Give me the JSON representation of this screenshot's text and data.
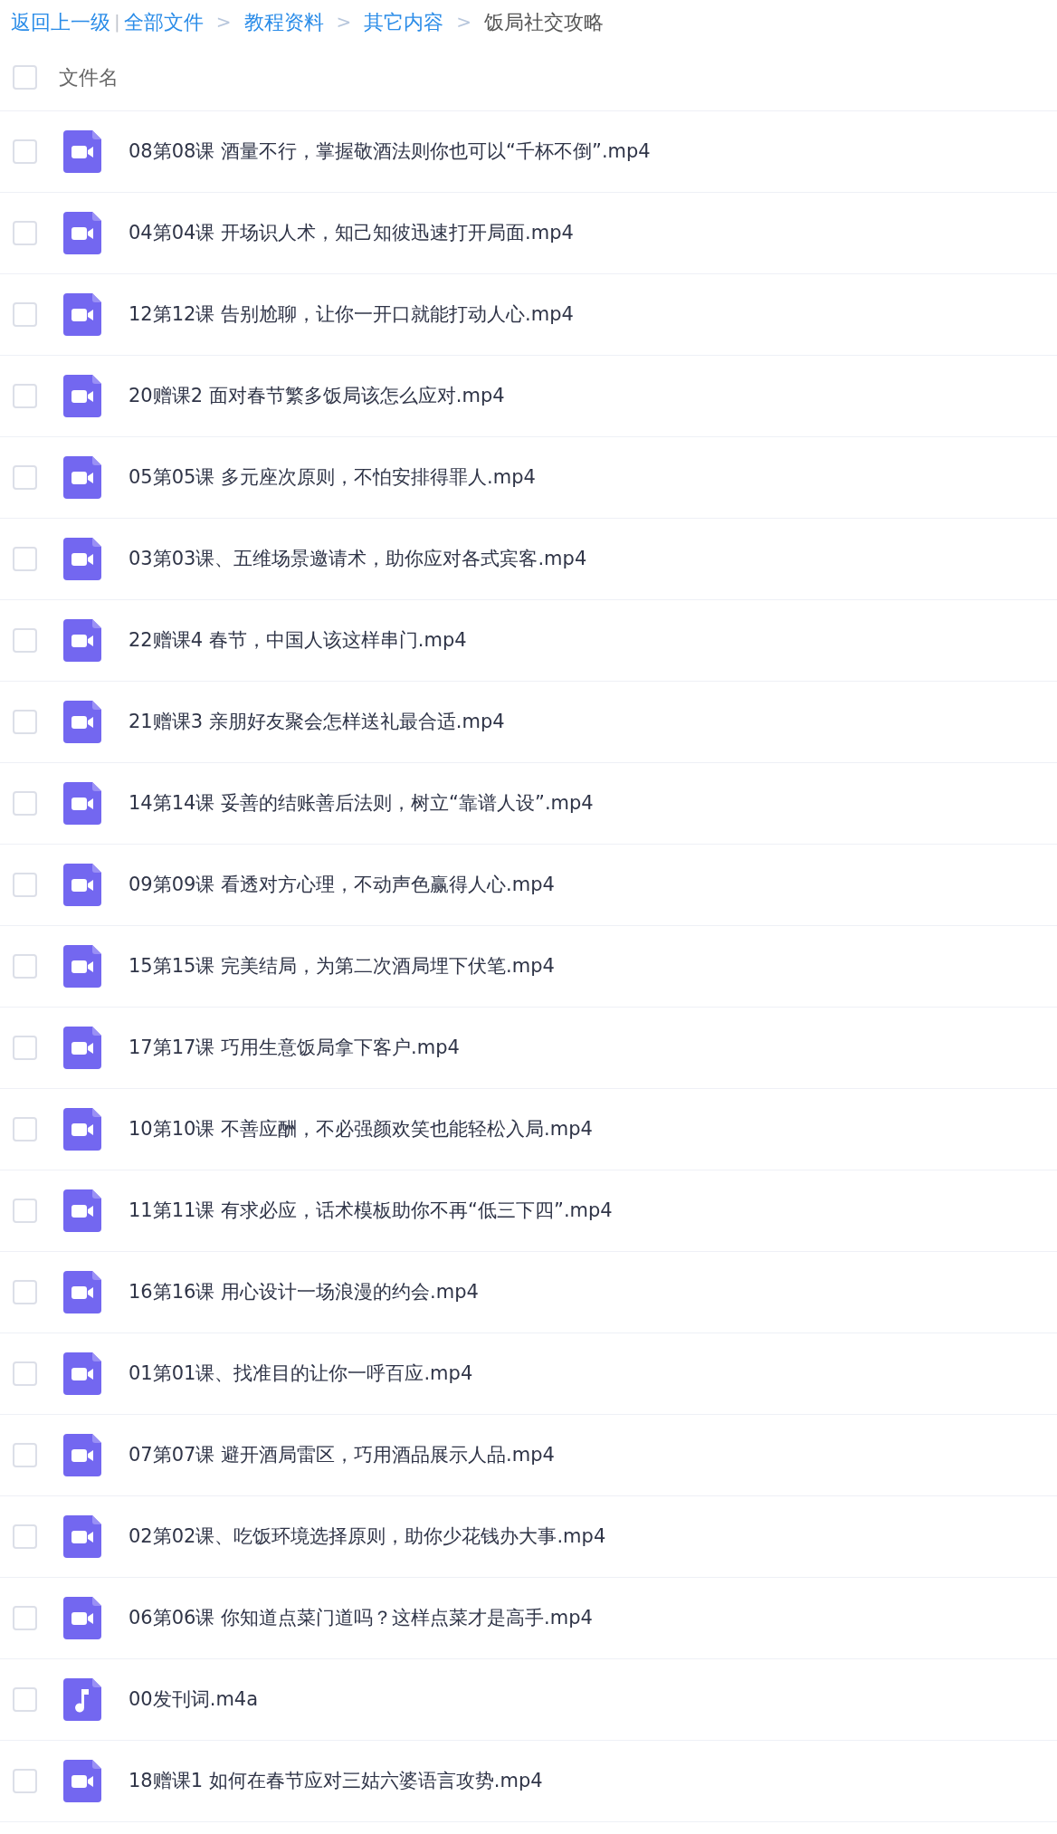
{
  "breadcrumb": [
    {
      "text": "返回上一级",
      "kind": "link"
    },
    {
      "text": "|",
      "kind": "divider"
    },
    {
      "text": "全部文件",
      "kind": "link"
    },
    {
      "text": ">",
      "kind": "separator"
    },
    {
      "text": "教程资料",
      "kind": "link"
    },
    {
      "text": ">",
      "kind": "separator"
    },
    {
      "text": "其它内容",
      "kind": "link"
    },
    {
      "text": ">",
      "kind": "separator"
    },
    {
      "text": "饭局社交攻略",
      "kind": "current"
    }
  ],
  "header": {
    "checked": false,
    "label": "文件名"
  },
  "files": [
    {
      "name": "08第08课 酒量不行，掌握敬酒法则你也可以“千杯不倒”.mp4",
      "kind": "video",
      "checked": false
    },
    {
      "name": "04第04课 开场识人术，知己知彼迅速打开局面.mp4",
      "kind": "video",
      "checked": false
    },
    {
      "name": "12第12课 告别尬聊，让你一开口就能打动人心.mp4",
      "kind": "video",
      "checked": false
    },
    {
      "name": "20赠课2 面对春节繁多饭局该怎么应对.mp4",
      "kind": "video",
      "checked": false
    },
    {
      "name": "05第05课 多元座次原则，不怕安排得罪人.mp4",
      "kind": "video",
      "checked": false
    },
    {
      "name": "03第03课、五维场景邀请术，助你应对各式宾客.mp4",
      "kind": "video",
      "checked": false
    },
    {
      "name": "22赠课4 春节，中国人该这样串门.mp4",
      "kind": "video",
      "checked": false
    },
    {
      "name": "21赠课3 亲朋好友聚会怎样送礼最合适.mp4",
      "kind": "video",
      "checked": false
    },
    {
      "name": "14第14课 妥善的结账善后法则，树立“靠谱人设”.mp4",
      "kind": "video",
      "checked": false
    },
    {
      "name": "09第09课 看透对方心理，不动声色赢得人心.mp4",
      "kind": "video",
      "checked": false
    },
    {
      "name": "15第15课 完美结局，为第二次酒局埋下伏笔.mp4",
      "kind": "video",
      "checked": false
    },
    {
      "name": "17第17课 巧用生意饭局拿下客户.mp4",
      "kind": "video",
      "checked": false
    },
    {
      "name": "10第10课 不善应酬，不必强颜欢笑也能轻松入局.mp4",
      "kind": "video",
      "checked": false
    },
    {
      "name": "11第11课 有求必应，话术模板助你不再“低三下四”.mp4",
      "kind": "video",
      "checked": false
    },
    {
      "name": "16第16课 用心设计一场浪漫的约会.mp4",
      "kind": "video",
      "checked": false
    },
    {
      "name": "01第01课、找准目的让你一呼百应.mp4",
      "kind": "video",
      "checked": false
    },
    {
      "name": "07第07课 避开酒局雷区，巧用酒品展示人品.mp4",
      "kind": "video",
      "checked": false
    },
    {
      "name": "02第02课、吃饭环境选择原则，助你少花钱办大事.mp4",
      "kind": "video",
      "checked": false
    },
    {
      "name": "06第06课 你知道点菜门道吗？这样点菜才是高手.mp4",
      "kind": "video",
      "checked": false
    },
    {
      "name": "00发刊词.m4a",
      "kind": "audio",
      "checked": false
    },
    {
      "name": "18赠课1 如何在春节应对三姑六婆语言攻势.mp4",
      "kind": "video",
      "checked": false
    }
  ]
}
